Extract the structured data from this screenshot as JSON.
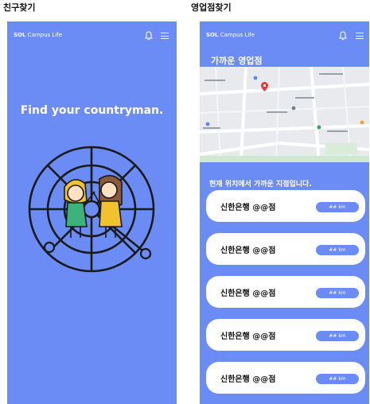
{
  "screens": {
    "friends": {
      "caption": "친구찾기",
      "brand_bold": "SOL",
      "brand_rest": " Campus Life",
      "headline": "Find your countryman."
    },
    "branch": {
      "caption": "영업점찾기",
      "brand_bold": "SOL",
      "brand_rest": " Campus Life",
      "section_title": "가까운 영업점",
      "nearby_label": "현재 위치에서 가까운 지점입니다.",
      "branches": [
        {
          "name": "신한은행 @@점",
          "distance": "## km"
        },
        {
          "name": "신한은행 @@점",
          "distance": "## km"
        },
        {
          "name": "신한은행 @@점",
          "distance": "## km"
        },
        {
          "name": "신한은행 @@점",
          "distance": "## km"
        },
        {
          "name": "신한은행 @@점",
          "distance": "## km"
        }
      ]
    }
  },
  "colors": {
    "phone_background": "#6b8cf5",
    "card_background": "#ffffff",
    "distance_pill": "#6b8cf5",
    "map_background": "#e8eaee",
    "map_marker": "#e53935"
  },
  "icons": {
    "notification": "bell-icon",
    "menu": "hamburger-menu-icon",
    "illustration": "radar-friends-illustration",
    "map_pin": "map-pin-icon"
  }
}
